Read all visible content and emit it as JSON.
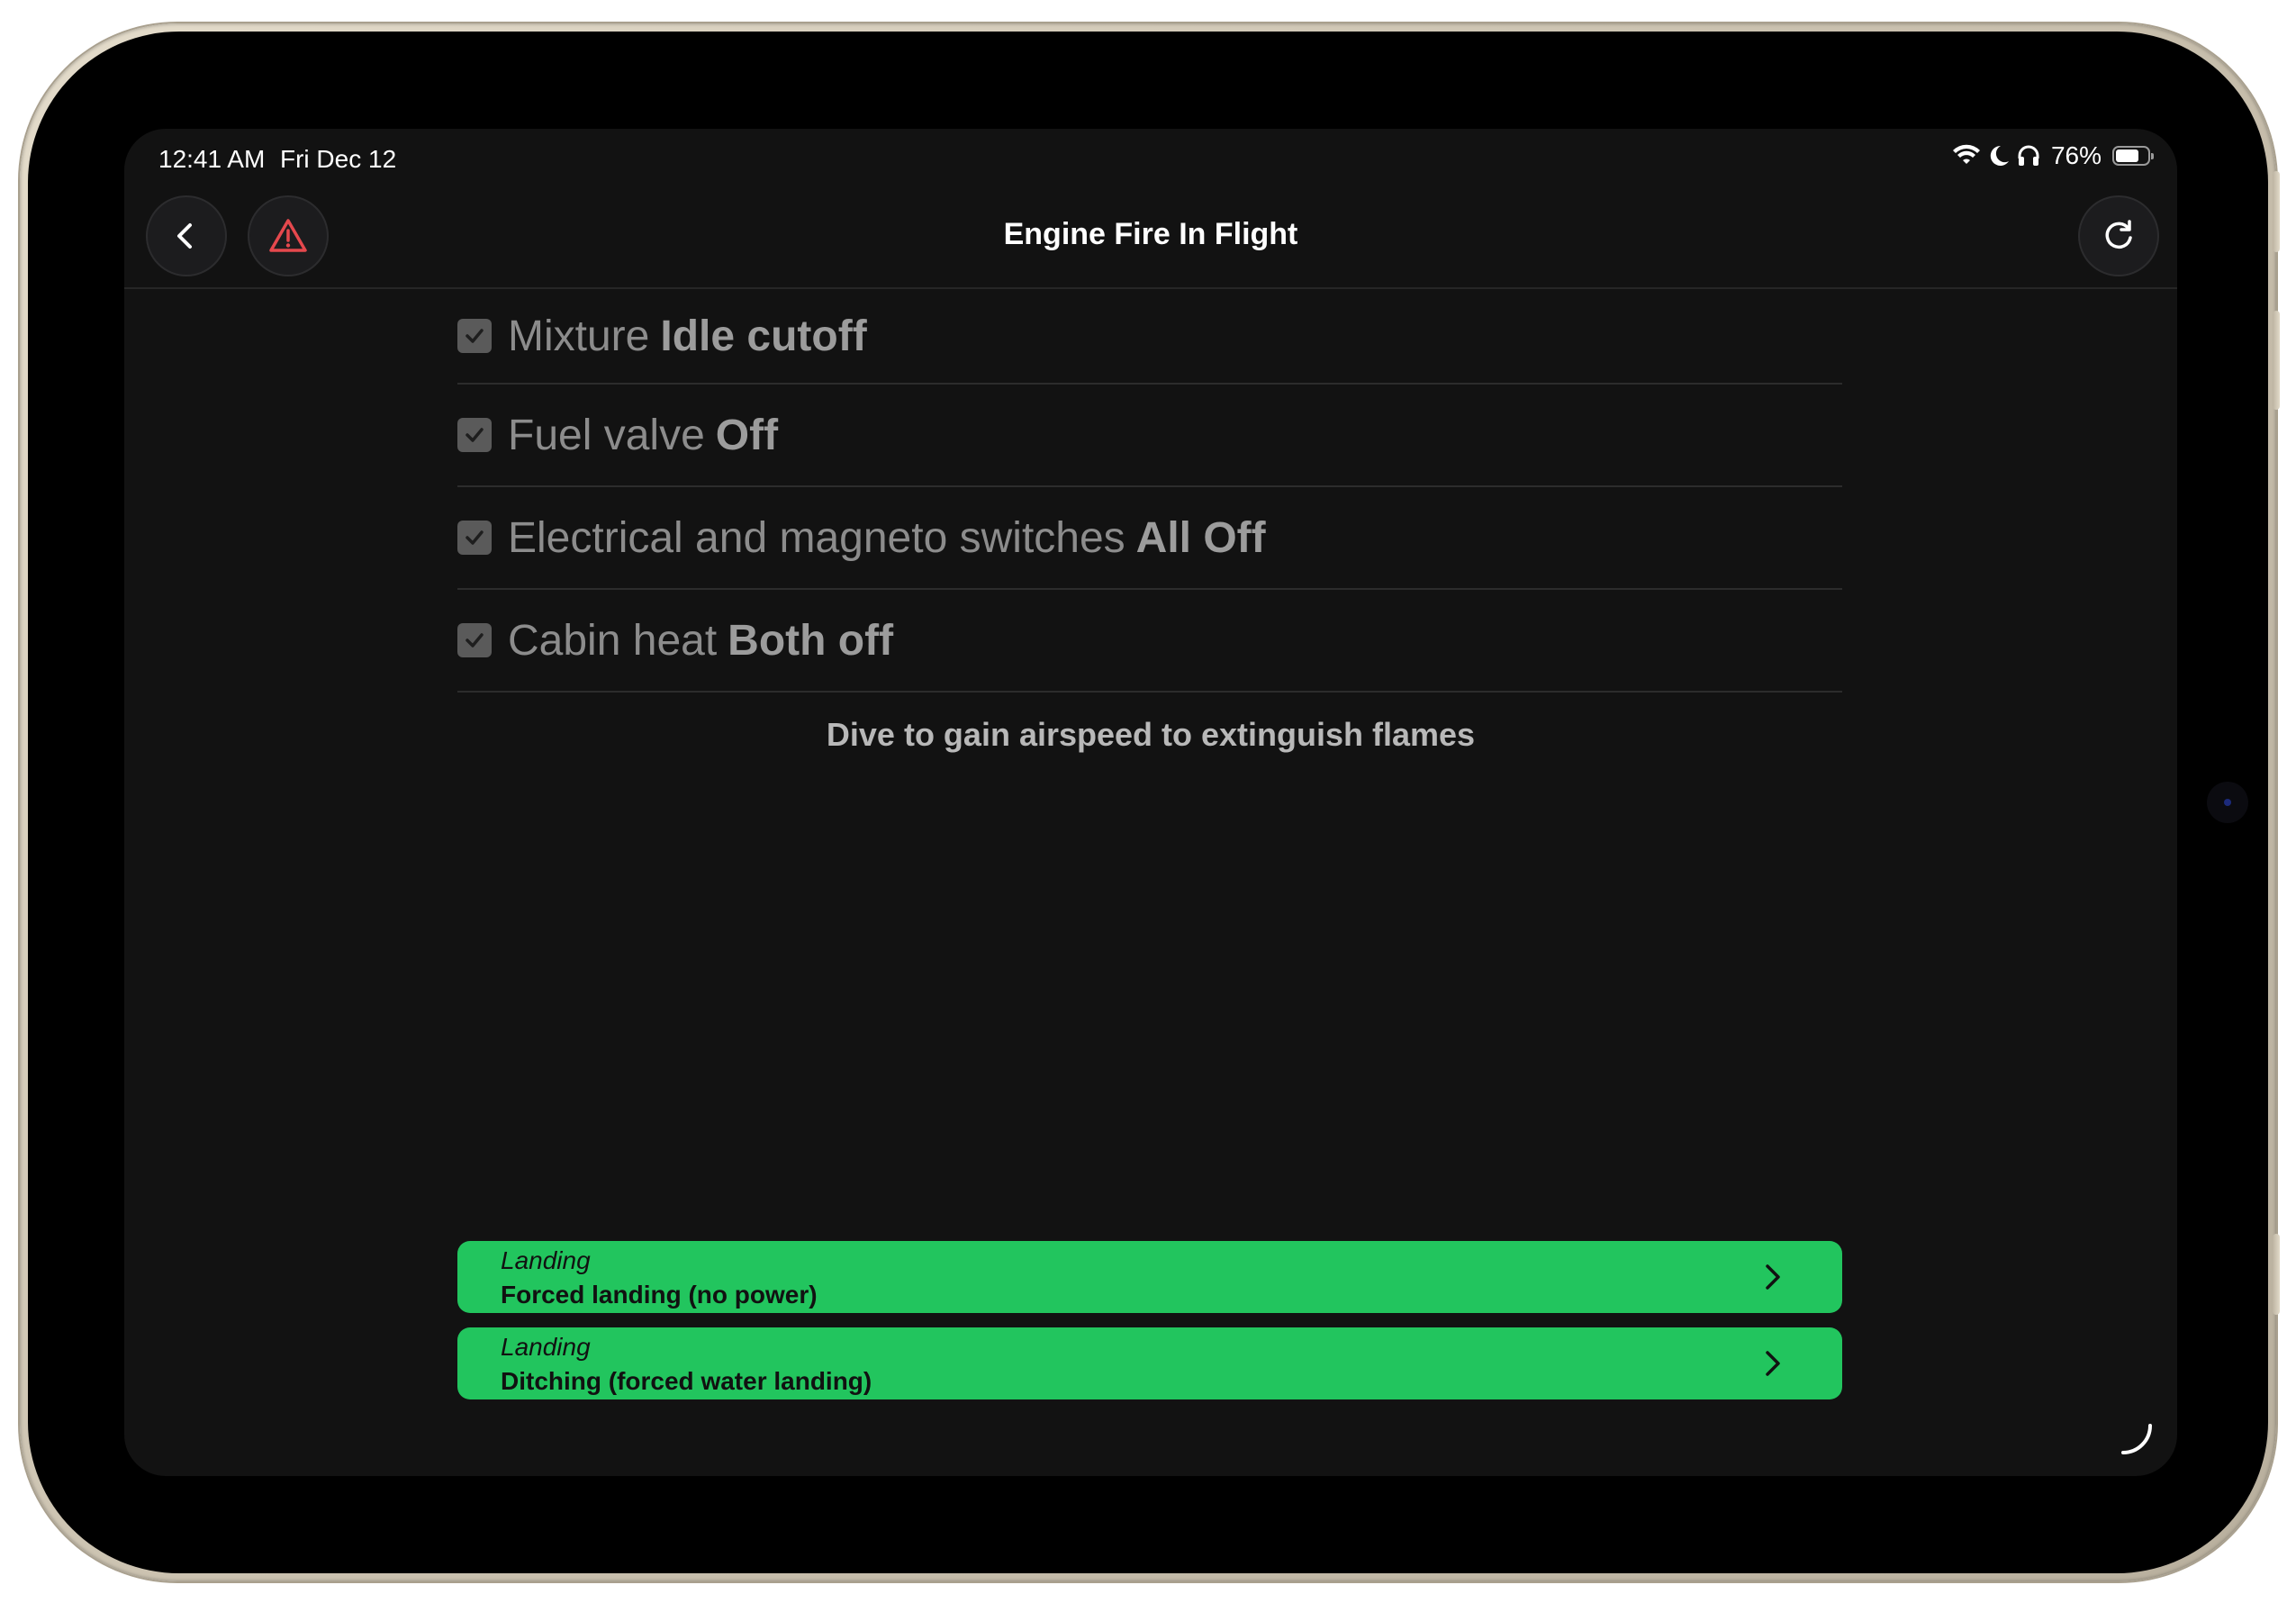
{
  "status_bar": {
    "time": "12:41 AM",
    "date": "Fri Dec 12",
    "battery_percent": "76%",
    "battery_level": 0.76,
    "icons": [
      "wifi-icon",
      "moon-icon",
      "headphones-icon",
      "battery-icon"
    ]
  },
  "navbar": {
    "title": "Engine Fire In Flight",
    "back_icon": "chevron-left-icon",
    "alert_icon": "warning-triangle-icon",
    "refresh_icon": "refresh-icon"
  },
  "checklist": {
    "items": [
      {
        "label": "Mixture",
        "action": "Idle cutoff",
        "checked": true
      },
      {
        "label": "Fuel valve",
        "action": "Off",
        "checked": true
      },
      {
        "label": "Electrical and magneto switches",
        "action": "All Off",
        "checked": true
      },
      {
        "label": "Cabin heat",
        "action": "Both off",
        "checked": true
      }
    ],
    "note": "Dive to gain airspeed to extinguish flames"
  },
  "links": [
    {
      "category": "Landing",
      "title": "Forced landing (no power)"
    },
    {
      "category": "Landing",
      "title": "Ditching (forced water landing)"
    }
  ],
  "colors": {
    "screen_background": "#121212",
    "link_card": "#22c55e",
    "alert_icon": "#e5484d",
    "checkbox": "#5a5a5a"
  }
}
